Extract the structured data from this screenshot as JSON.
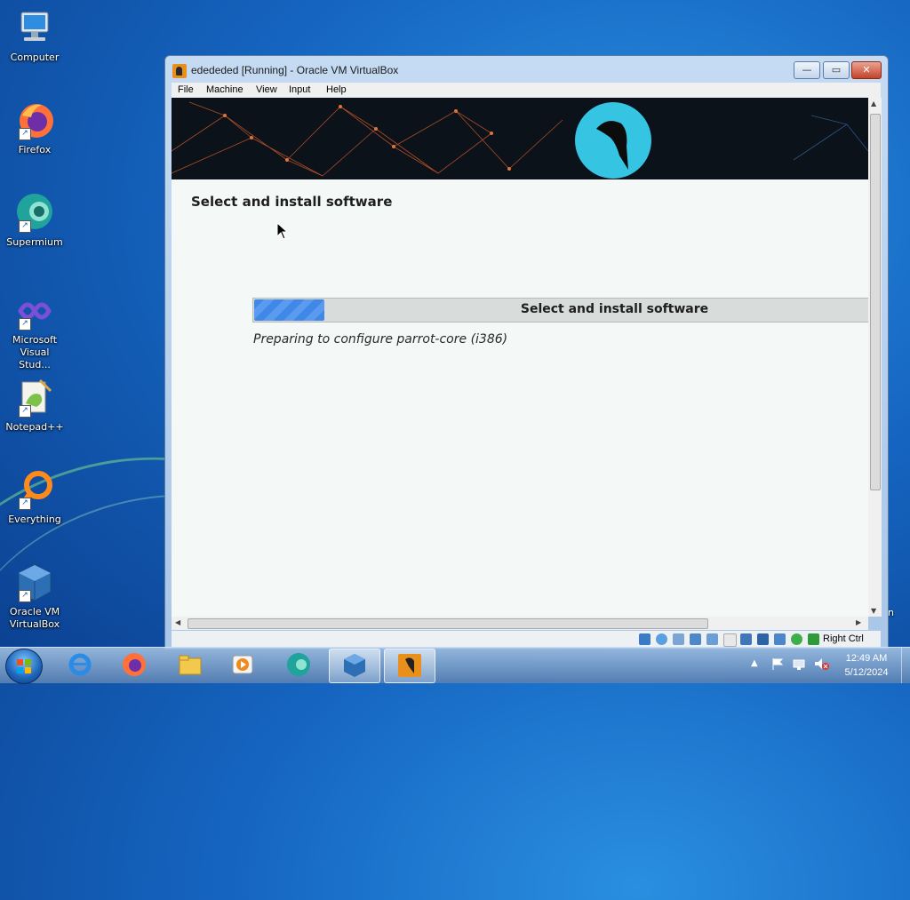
{
  "desktop": {
    "icons": [
      {
        "label": "Computer"
      },
      {
        "label": "Firefox"
      },
      {
        "label": "Supermium"
      },
      {
        "label": "Microsoft Visual Stud..."
      },
      {
        "label": "Notepad++"
      },
      {
        "label": "Everything"
      },
      {
        "label": "Oracle VM VirtualBox"
      }
    ],
    "partial_label_right": "n"
  },
  "window": {
    "title": "edededed [Running] - Oracle VM VirtualBox",
    "buttons": {
      "minimize": "—",
      "maximize": "▭",
      "close": "✕"
    },
    "menu": [
      "File",
      "Machine",
      "View",
      "Input",
      "Help"
    ]
  },
  "installer": {
    "page_title": "Select and install software",
    "progress_label": "Select and install software",
    "progress_fraction": 0.115,
    "status_text": "Preparing to configure parrot-core (i386)"
  },
  "statusbar": {
    "host_key": "Right Ctrl",
    "icons": [
      "hard-disk-icon",
      "optical-drive-icon",
      "audio-icon",
      "network-icon",
      "usb-icon",
      "shared-folders-icon",
      "display-icon",
      "recording-icon",
      "vt-x-icon",
      "mouse-integration-icon",
      "host-key-arrow-icon"
    ]
  },
  "taskbar": {
    "apps": [
      "internet-explorer",
      "firefox",
      "file-explorer",
      "media-player",
      "supermium",
      "virtualbox",
      "virtualbox-vm"
    ],
    "active_app": "virtualbox",
    "time": "12:49 AM",
    "date": "5/12/2024"
  },
  "colors": {
    "accent": "#3f88e8",
    "parrot_cyan": "#35c4e2",
    "close_red": "#c4432a"
  }
}
